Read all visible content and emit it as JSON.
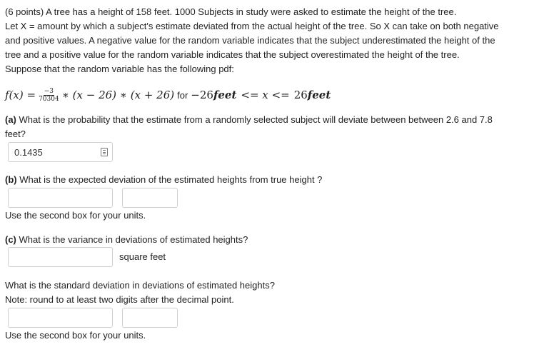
{
  "problem": {
    "intro_lines": [
      "(6 points) A tree has a height of 158 feet. 1000 Subjects in study were asked to estimate the height of the tree.",
      "Let X = amount by which a subject's estimate deviated from the actual height of the tree. So X can take on both negative",
      "and positive values. A negative value for the random variable indicates that the subject underestimated the height of the",
      "tree and a positive value for the random variable indicates that the subject overestimated the height of the tree.",
      "Suppose that the random variable has the following pdf:"
    ],
    "formula": {
      "lhs": "f(x) =",
      "frac_num": "−3",
      "frac_den": "70304",
      "body": "∗ (x − 26) ∗ (x + 26)",
      "for_word": "for",
      "range_start": "−26",
      "range_unit_1": "feet",
      "range_mid": "<= x <=",
      "range_end": "26",
      "range_unit_2": "feet"
    }
  },
  "part_a": {
    "label": "(a)",
    "text_line1": " What is the probability that the estimate from a randomly selected subject will deviate between between 2.6 and 7.8",
    "text_line2": "feet?",
    "answer_value": "0.1435"
  },
  "part_b": {
    "label": "(b)",
    "text": " What is the expected deviation of the estimated heights from true height ?",
    "answer_value": "",
    "unit_value": "",
    "note": "Use the second box for your units."
  },
  "part_c": {
    "label": "(c)",
    "text": " What is the variance in deviations of estimated heights?",
    "answer_value": "",
    "unit_label": "square feet"
  },
  "part_sd": {
    "text": "What is the standard deviation in deviations of estimated heights?",
    "note_round": "Note: round to at least two digits after the decimal point.",
    "answer_value": "",
    "unit_value": "",
    "note": "Use the second box for your units."
  }
}
